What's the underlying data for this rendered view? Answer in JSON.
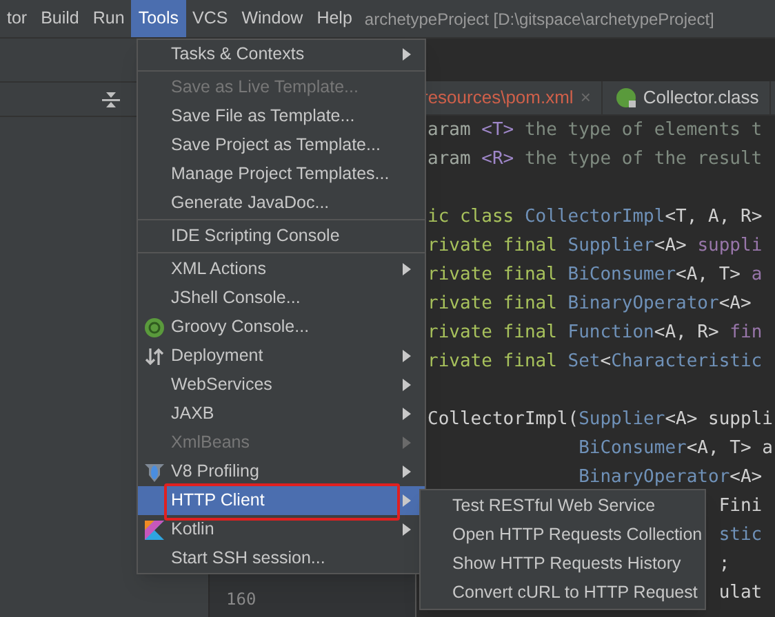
{
  "menu_bar": {
    "items": [
      {
        "label": "tor",
        "selected": false
      },
      {
        "label": "Build",
        "selected": false
      },
      {
        "label": "Run",
        "selected": false
      },
      {
        "label": "Tools",
        "selected": true
      },
      {
        "label": "VCS",
        "selected": false
      },
      {
        "label": "Window",
        "selected": false
      },
      {
        "label": "Help",
        "selected": false
      }
    ],
    "title": "archetypeProject [D:\\gitspace\\archetypeProject]"
  },
  "editor_tabs": [
    {
      "label": "resources\\pom.xml",
      "kind": "error",
      "close": "×"
    },
    {
      "label": "Collector.class",
      "kind": "class"
    }
  ],
  "code_blocks": [
    [
      {
        "tokens": [
          {
            "color": "#a0a8a0",
            "t": "aram"
          },
          {
            "color": "#9e86c8",
            "t": " <T>"
          },
          {
            "color": "#7f8b80",
            "t": " the type of elements t"
          }
        ]
      },
      {
        "tokens": [
          {
            "color": "#a0a8a0",
            "t": "aram"
          },
          {
            "color": "#9e86c8",
            "t": " <R>"
          },
          {
            "color": "#7f8b80",
            "t": " the type of the result"
          }
        ]
      }
    ],
    [
      {
        "tokens": [
          {
            "color": "#a8c25c",
            "t": "ic class "
          },
          {
            "color": "#6f91b8",
            "t": "CollectorImpl"
          },
          {
            "color": "#d0d0d0",
            "t": "<T, A, R>"
          }
        ]
      },
      {
        "tokens": [
          {
            "color": "#a8c25c",
            "t": "rivate final "
          },
          {
            "color": "#6f91b8",
            "t": "Supplier"
          },
          {
            "color": "#d0d0d0",
            "t": "<A> "
          },
          {
            "color": "#9876aa",
            "t": "suppli"
          }
        ]
      },
      {
        "tokens": [
          {
            "color": "#a8c25c",
            "t": "rivate final "
          },
          {
            "color": "#6f91b8",
            "t": "BiConsumer"
          },
          {
            "color": "#d0d0d0",
            "t": "<A, T> "
          },
          {
            "color": "#9876aa",
            "t": "a"
          }
        ]
      },
      {
        "tokens": [
          {
            "color": "#a8c25c",
            "t": "rivate final "
          },
          {
            "color": "#6f91b8",
            "t": "BinaryOperator"
          },
          {
            "color": "#d0d0d0",
            "t": "<A>"
          }
        ]
      },
      {
        "tokens": [
          {
            "color": "#a8c25c",
            "t": "rivate final "
          },
          {
            "color": "#6f91b8",
            "t": "Function"
          },
          {
            "color": "#d0d0d0",
            "t": "<A, R> "
          },
          {
            "color": "#9876aa",
            "t": "fin"
          }
        ]
      },
      {
        "tokens": [
          {
            "color": "#a8c25c",
            "t": "rivate final "
          },
          {
            "color": "#6f91b8",
            "t": "Set"
          },
          {
            "color": "#d0d0d0",
            "t": "<"
          },
          {
            "color": "#6f91b8",
            "t": "Characteristic"
          }
        ]
      }
    ],
    [
      {
        "tokens": [
          {
            "color": "#d0d0d0",
            "t": "CollectorImpl("
          },
          {
            "color": "#6f91b8",
            "t": "Supplier"
          },
          {
            "color": "#d0d0d0",
            "t": "<A> suppli"
          }
        ]
      },
      {
        "tokens": [
          {
            "color": "#6f91b8",
            "t": "              BiConsumer"
          },
          {
            "color": "#d0d0d0",
            "t": "<A, T> a"
          }
        ]
      },
      {
        "tokens": [
          {
            "color": "#6f91b8",
            "t": "              BinaryOperator"
          },
          {
            "color": "#d0d0d0",
            "t": "<A>"
          }
        ]
      },
      {
        "tokens": [
          {
            "color": "#d0d0d0",
            "t": "                           Fini"
          }
        ]
      },
      {
        "tokens": [
          {
            "color": "#6f91b8",
            "t": "                           stic"
          }
        ]
      },
      {
        "tokens": [
          {
            "color": "#d0d0d0",
            "t": "                           ;"
          }
        ]
      },
      {
        "tokens": [
          {
            "color": "#d0d0d0",
            "t": "                           ulat"
          }
        ]
      }
    ]
  ],
  "line_number": "160",
  "tools_menu": {
    "items": [
      {
        "kind": "item",
        "label": "Tasks & Contexts",
        "submenu": true,
        "disabled": false,
        "selected": false,
        "highlighted": false
      },
      {
        "kind": "separator"
      },
      {
        "kind": "item",
        "label": "Save as Live Template...",
        "submenu": false,
        "disabled": true,
        "selected": false,
        "highlighted": false
      },
      {
        "kind": "item",
        "label": "Save File as Template...",
        "submenu": false,
        "disabled": false,
        "selected": false,
        "highlighted": false
      },
      {
        "kind": "item",
        "label": "Save Project as Template...",
        "submenu": false,
        "disabled": false,
        "selected": false,
        "highlighted": false
      },
      {
        "kind": "item",
        "label": "Manage Project Templates...",
        "submenu": false,
        "disabled": false,
        "selected": false,
        "highlighted": false
      },
      {
        "kind": "item",
        "label": "Generate JavaDoc...",
        "submenu": false,
        "disabled": false,
        "selected": false,
        "highlighted": false
      },
      {
        "kind": "separator"
      },
      {
        "kind": "item",
        "label": "IDE Scripting Console",
        "submenu": false,
        "disabled": false,
        "selected": false,
        "highlighted": false
      },
      {
        "kind": "separator"
      },
      {
        "kind": "item",
        "label": "XML Actions",
        "submenu": true,
        "disabled": false,
        "selected": false,
        "highlighted": false
      },
      {
        "kind": "item",
        "label": "JShell Console...",
        "submenu": false,
        "disabled": false,
        "selected": false,
        "highlighted": false
      },
      {
        "kind": "groovy",
        "label": "Groovy Console...",
        "submenu": false,
        "disabled": false,
        "selected": false,
        "highlighted": false
      },
      {
        "kind": "deployment",
        "label": "Deployment",
        "submenu": true,
        "disabled": false,
        "selected": false,
        "highlighted": false
      },
      {
        "kind": "item",
        "label": "WebServices",
        "submenu": true,
        "disabled": false,
        "selected": false,
        "highlighted": false
      },
      {
        "kind": "item",
        "label": "JAXB",
        "submenu": true,
        "disabled": false,
        "selected": false,
        "highlighted": false
      },
      {
        "kind": "item",
        "label": "XmlBeans",
        "submenu": true,
        "disabled": true,
        "selected": false,
        "highlighted": false
      },
      {
        "kind": "profiler",
        "label": "V8 Profiling",
        "submenu": true,
        "disabled": false,
        "selected": false,
        "highlighted": false
      },
      {
        "kind": "item",
        "label": "HTTP Client",
        "submenu": true,
        "disabled": false,
        "selected": true,
        "highlighted": true
      },
      {
        "kind": "kotlin",
        "label": "Kotlin",
        "submenu": true,
        "disabled": false,
        "selected": false,
        "highlighted": false
      },
      {
        "kind": "item",
        "label": "Start SSH session...",
        "submenu": false,
        "disabled": false,
        "selected": false,
        "highlighted": false
      }
    ]
  },
  "submenu": {
    "items": [
      {
        "label": "Test RESTful Web Service"
      },
      {
        "label": "Open HTTP Requests Collection"
      },
      {
        "label": "Show HTTP Requests History"
      },
      {
        "label": "Convert cURL to HTTP Request"
      }
    ]
  }
}
